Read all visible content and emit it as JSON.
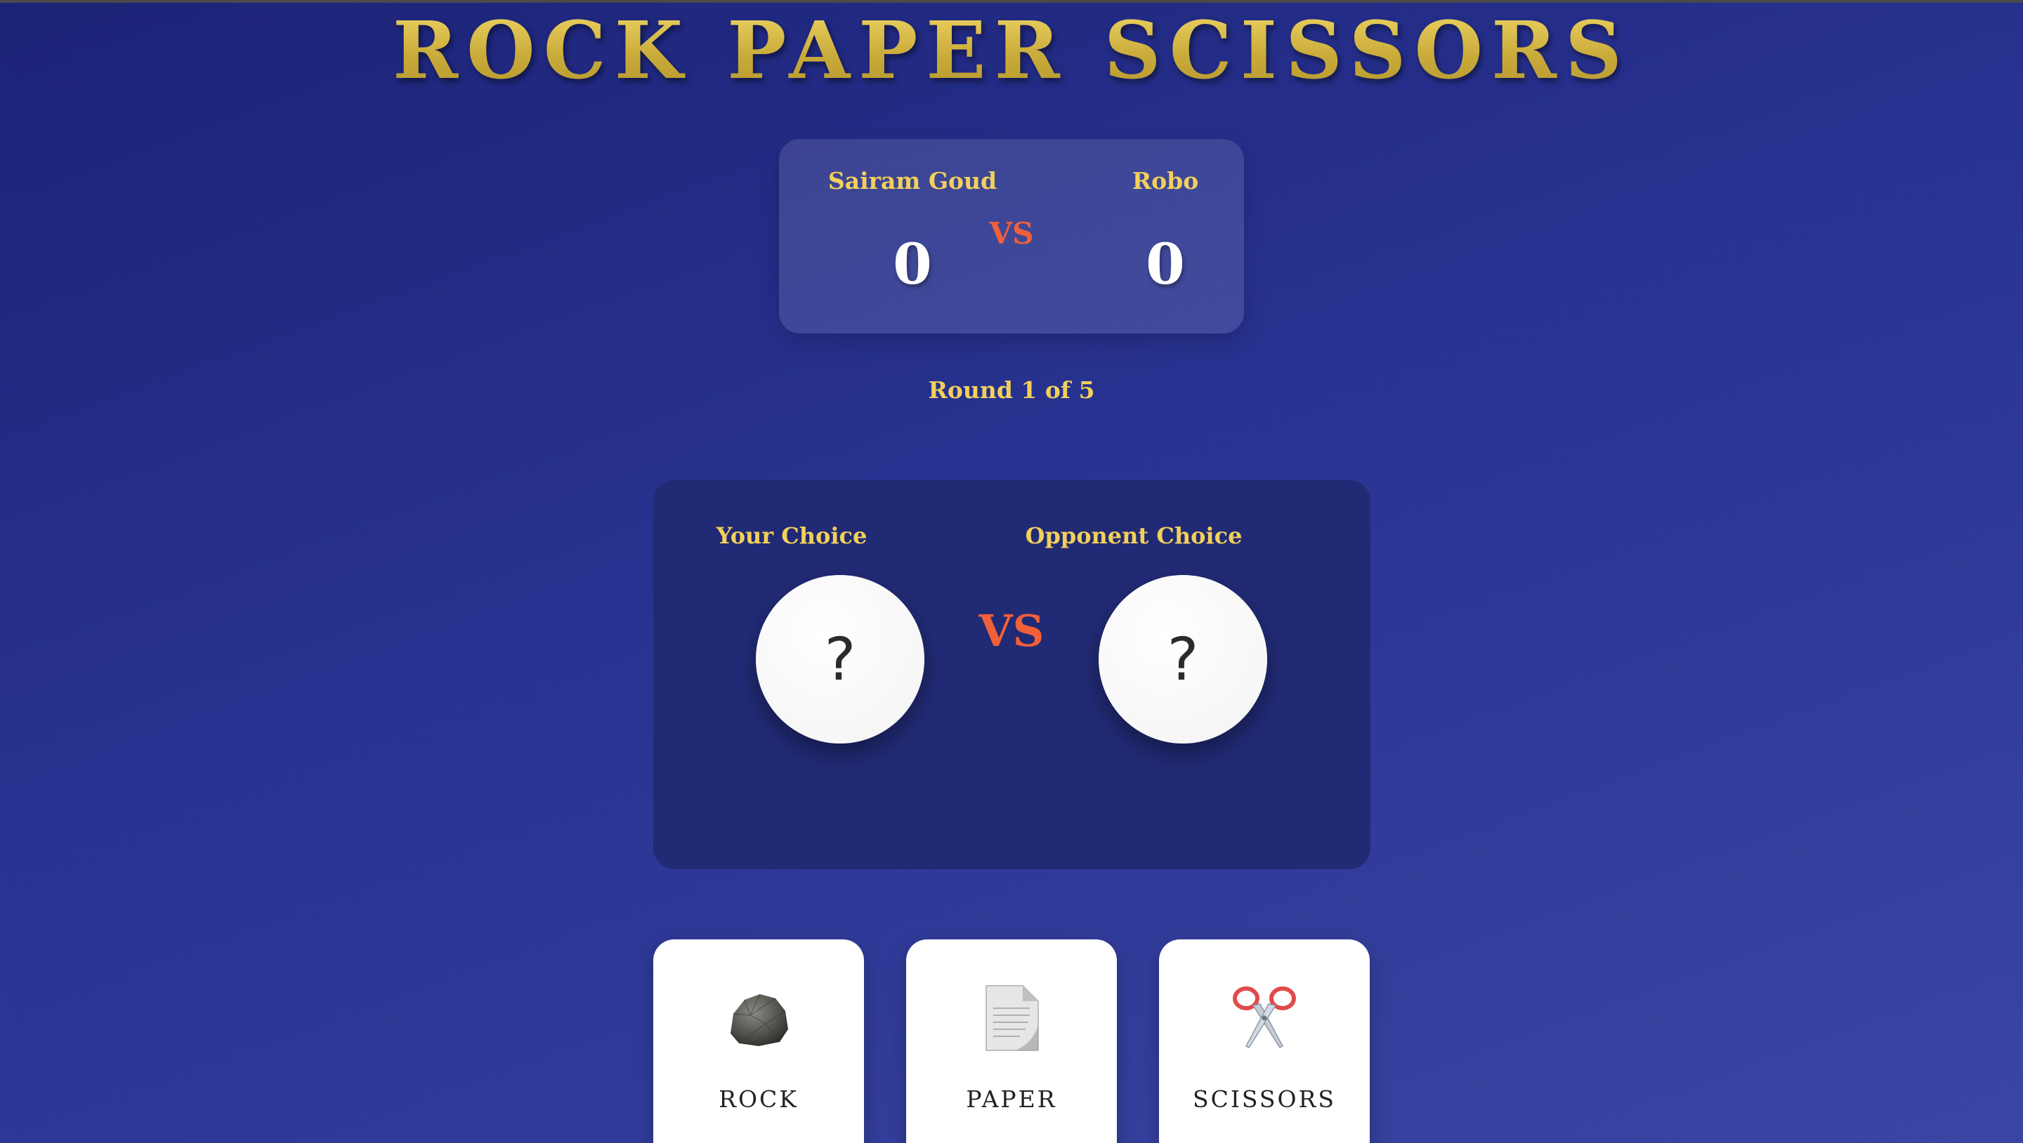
{
  "title": "ROCK PAPER SCISSORS",
  "scoreboard": {
    "player_name": "Sairam Goud",
    "opponent_name": "Robo",
    "vs_label": "VS",
    "player_score": "0",
    "opponent_score": "0"
  },
  "round_text": "Round 1 of 5",
  "arena": {
    "your_choice_label": "Your Choice",
    "opponent_choice_label": "Opponent Choice",
    "your_choice_value": "?",
    "opponent_choice_value": "?",
    "vs_label": "VS"
  },
  "moves": [
    {
      "label": "ROCK",
      "icon": "rock-icon"
    },
    {
      "label": "PAPER",
      "icon": "paper-icon"
    },
    {
      "label": "SCISSORS",
      "icon": "scissors-icon"
    }
  ],
  "colors": {
    "background": "#283391",
    "title_gold": "#d8bd4a",
    "accent_yellow": "#f2d05a",
    "vs_orange": "#f2603a",
    "arena_panel": "#212a74",
    "card": "#ffffff"
  }
}
